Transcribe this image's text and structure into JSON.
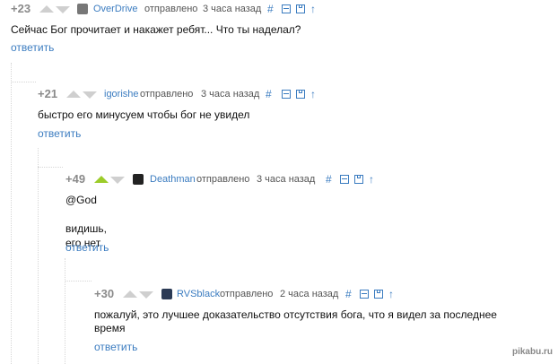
{
  "comments": [
    {
      "rating": "+23",
      "username": "OverDrive",
      "posted_label": "отправлено",
      "time": "3 часа назад",
      "lines": [
        "Сейчас Бог прочитает и накажет ребят... Что ты наделал?"
      ],
      "reply_label": "ответить"
    },
    {
      "rating": "+21",
      "username": "igorishe",
      "posted_label": "отправлено",
      "time": "3 часа назад",
      "lines": [
        "быстро его минусуем чтобы бог не увидел"
      ],
      "reply_label": "ответить"
    },
    {
      "rating": "+49",
      "username": "Deathman",
      "posted_label": "отправлено",
      "time": "3 часа назад",
      "lines": [
        "@God",
        "видишь, его нет"
      ],
      "reply_label": "ответить"
    },
    {
      "rating": "+30",
      "username": "RVSblack",
      "posted_label": "отправлено",
      "time": "2 часа назад",
      "lines": [
        "пожалуй, это лучшее доказательство отсутствия бога, что я видел за последнее",
        "время"
      ],
      "reply_label": "ответить"
    }
  ],
  "icons": {
    "link": "#",
    "collapse": "minus-box-icon",
    "save": "save-icon",
    "up": "↑",
    "vote_up": "vote-up-icon",
    "vote_down": "vote-down-icon"
  },
  "watermark": "pikabu.ru",
  "colors": {
    "link": "#3b7cc0",
    "rating": "#8a8a8a",
    "voted_up": "#9ccc2a",
    "arrow": "#cfcfcf"
  }
}
